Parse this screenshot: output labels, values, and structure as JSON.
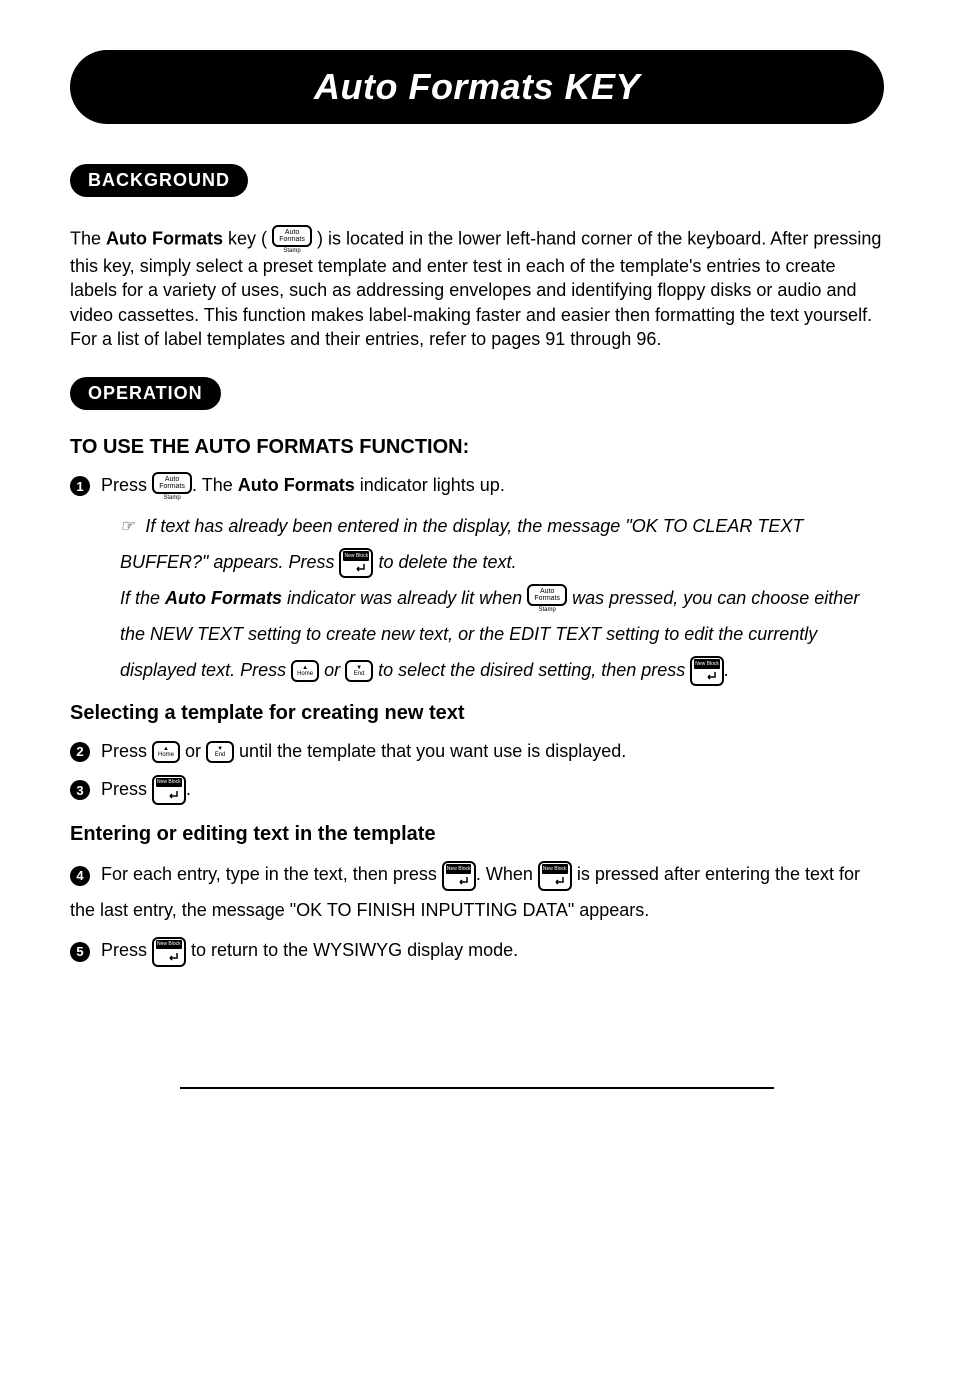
{
  "title": "Auto Formats KEY",
  "sections": {
    "background": {
      "pill": "BACKGROUND",
      "para_pre": "The ",
      "para_bold1": "Auto Formats",
      "para_mid1": " key ( ",
      "para_mid2": " ) is located in the lower left-hand corner of the keyboard.  After pressing this key, simply select a preset template and enter test in each of the template's entries to create labels for a variety of uses, such as addressing envelopes and identifying floppy disks or audio and video cassettes. This function makes label-making faster and easier then formatting the text yourself.  For a list of label templates and their entries, refer to pages 91 through 96."
    },
    "operation": {
      "pill": "OPERATION",
      "head": "TO USE THE AUTO FORMATS FUNCTION:",
      "step1_a": "Press ",
      "step1_b": ". The ",
      "step1_bold": "Auto Formats",
      "step1_c": " indicator lights up.",
      "note_a": "If text has already been entered in the display, the message \"OK TO CLEAR TEXT BUFFER?\" appears.  Press ",
      "note_b": " to delete the text.",
      "note_c_pre": "If the ",
      "note_c_bold": "Auto Formats",
      "note_c_mid": " indicator was already lit when ",
      "note_c_mid2": " was pressed, you can choose either the NEW TEXT setting to create new text, or the EDIT TEXT setting to edit the currently displayed text.  Press ",
      "note_c_or": " or ",
      "note_c_end": " to select the disired setting, then press ",
      "note_c_period": ".",
      "sel_head": "Selecting a template for creating new text",
      "step2_a": "Press ",
      "step2_or": " or ",
      "step2_b": " until the template that you want use is displayed.",
      "step3_a": "Press ",
      "step3_b": ".",
      "enter_head": "Entering or editing text in the template",
      "step4_a": "For each entry, type in the text, then press ",
      "step4_b": ". When ",
      "step4_c": " is pressed after entering the text for the last entry, the message \"OK TO FINISH INPUTTING DATA\" appears.",
      "step5_a": "Press ",
      "step5_b": " to return to the WYSIWYG display mode."
    }
  },
  "keys": {
    "auto_formats_top": "Auto",
    "auto_formats_bot": "Formats",
    "stamp": "Stamp",
    "new_block": "New Block",
    "home_sym": "▲",
    "home_txt": "Home",
    "end_sym": "▼",
    "end_txt": "End"
  },
  "nums": {
    "n1": "1",
    "n2": "2",
    "n3": "3",
    "n4": "4",
    "n5": "5"
  }
}
